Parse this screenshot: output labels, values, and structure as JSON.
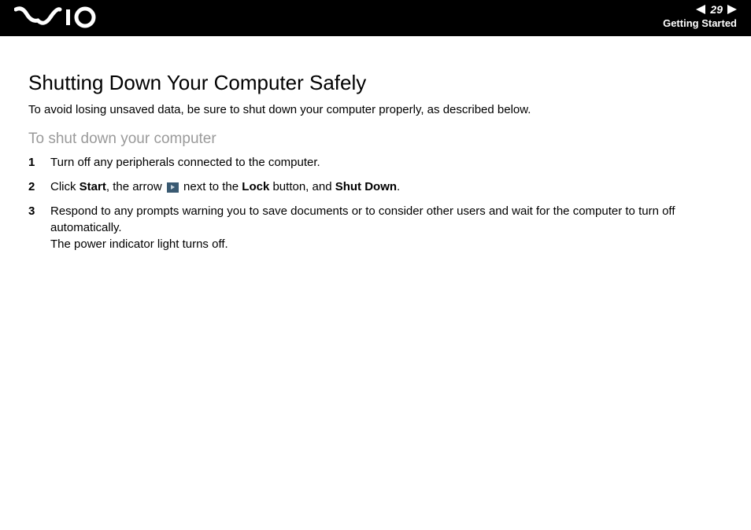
{
  "header": {
    "page_number": "29",
    "section": "Getting Started"
  },
  "title": "Shutting Down Your Computer Safely",
  "intro": "To avoid losing unsaved data, be sure to shut down your computer properly, as described below.",
  "subhead": "To shut down your computer",
  "steps": {
    "s1": "Turn off any peripherals connected to the computer.",
    "s2a": "Click ",
    "s2_start": "Start",
    "s2b": ", the arrow ",
    "s2c": " next to the ",
    "s2_lock": "Lock",
    "s2d": " button, and ",
    "s2_shut": "Shut Down",
    "s2e": ".",
    "s3a": "Respond to any prompts warning you to save documents or to consider other users and wait for the computer to turn off automatically.",
    "s3b": "The power indicator light turns off."
  }
}
